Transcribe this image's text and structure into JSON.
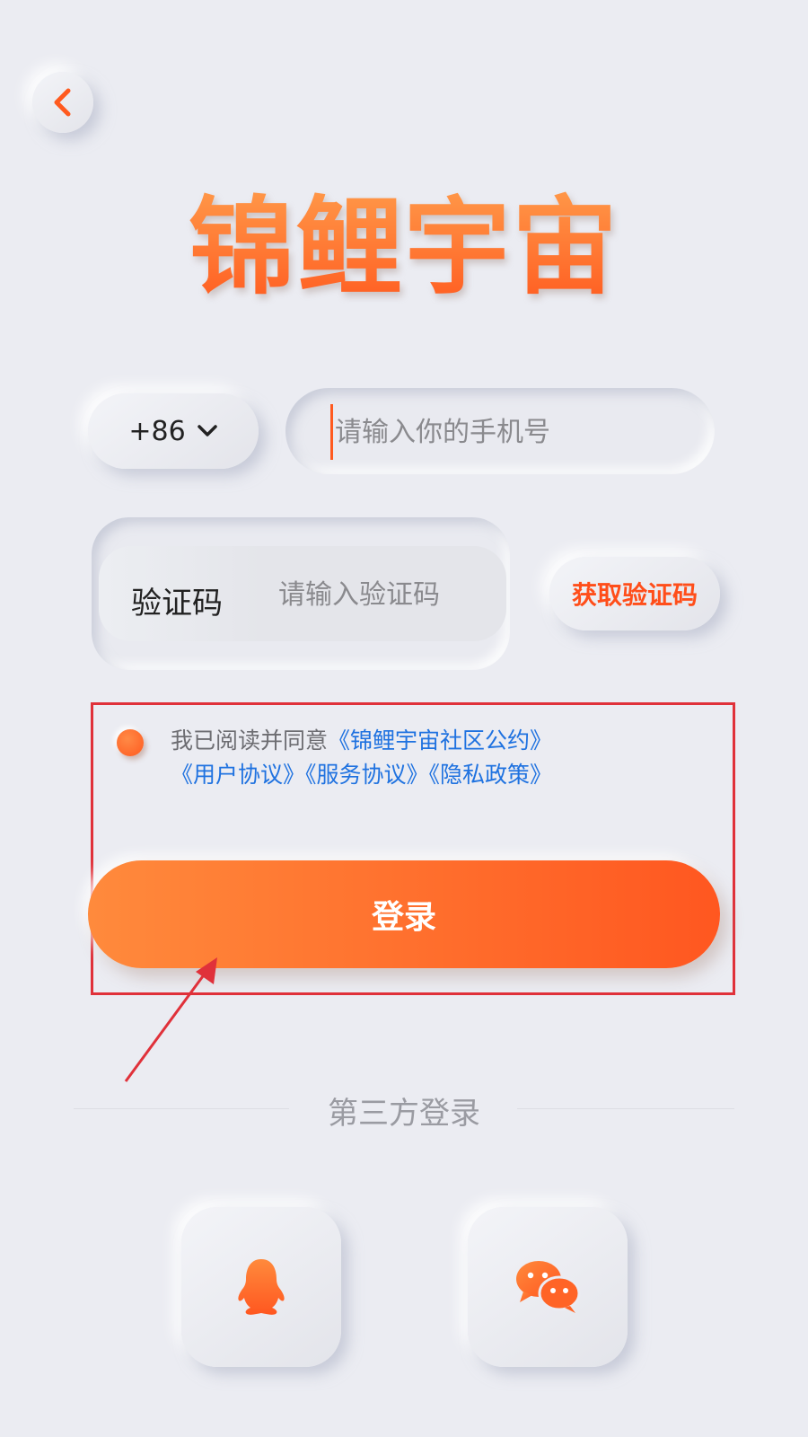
{
  "logo": {
    "text": "锦鲤宇宙"
  },
  "phone": {
    "country_code": "+86",
    "placeholder": "请输入你的手机号"
  },
  "code": {
    "label": "验证码",
    "placeholder": "请输入验证码",
    "get_code_label": "获取验证码"
  },
  "agreement": {
    "prefix": "我已阅读并同意",
    "links": [
      "《锦鲤宇宙社区公约》",
      "《用户协议》",
      "《服务协议》",
      "《隐私政策》"
    ]
  },
  "login": {
    "label": "登录"
  },
  "third_party": {
    "title": "第三方登录",
    "providers": [
      {
        "icon": "qq-icon"
      },
      {
        "icon": "wechat-icon"
      }
    ]
  },
  "colors": {
    "accent": "#ff5a1f",
    "link": "#1f72e0",
    "background": "#ebecf2",
    "annotation": "#e0313a"
  },
  "icons": {
    "back": "chevron-left-icon",
    "dropdown": "chevron-down-icon"
  }
}
